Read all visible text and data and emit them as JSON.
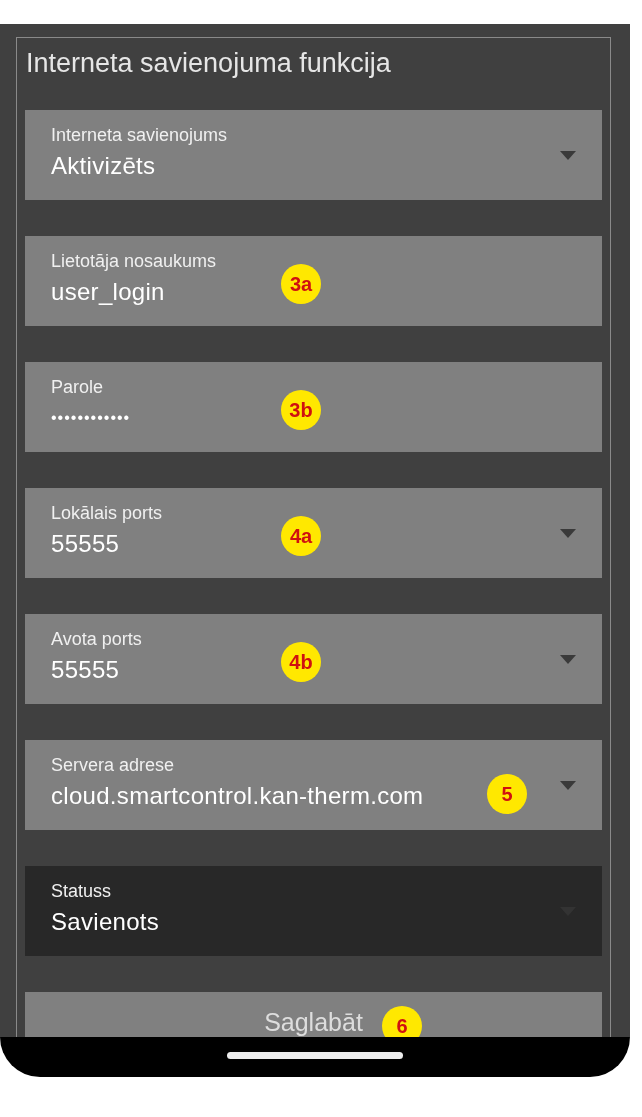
{
  "section": {
    "title": "Interneta savienojuma funkcija"
  },
  "fields": [
    {
      "kind": "dropdown",
      "label": "Interneta savienojums",
      "value": "Aktivizēts",
      "disabled": false
    },
    {
      "kind": "text",
      "label": "Lietotāja nosaukums",
      "value": "user_login",
      "disabled": false,
      "callout": "3a"
    },
    {
      "kind": "text",
      "label": "Parole",
      "value": "••••••••••••",
      "disabled": false,
      "callout": "3b"
    },
    {
      "kind": "dropdown",
      "label": "Lokālais ports",
      "value": "55555",
      "disabled": false,
      "callout": "4a"
    },
    {
      "kind": "dropdown",
      "label": "Avota ports",
      "value": "55555",
      "disabled": false,
      "callout": "4b"
    },
    {
      "kind": "dropdown",
      "label": "Servera adrese",
      "value": "cloud.smartcontrol.kan-therm.com",
      "disabled": false,
      "callout": "5"
    },
    {
      "kind": "dropdown",
      "label": "Statuss",
      "value": "Savienots",
      "disabled": true
    }
  ],
  "save_button": {
    "label": "Saglabāt",
    "callout": "6"
  }
}
